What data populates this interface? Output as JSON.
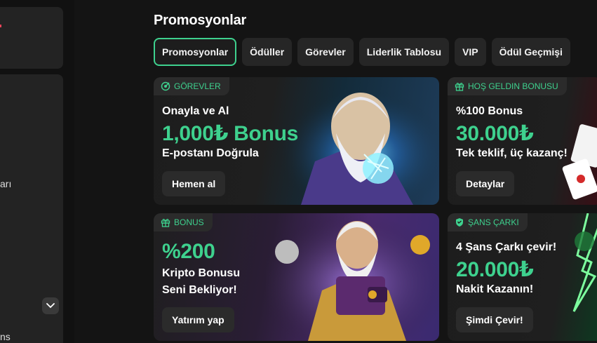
{
  "sidebar": {
    "partial_text_1": "arı",
    "partial_text_2": "ns"
  },
  "page": {
    "title": "Promosyonlar"
  },
  "tabs": [
    {
      "label": "Promosyonlar"
    },
    {
      "label": "Ödüller"
    },
    {
      "label": "Görevler"
    },
    {
      "label": "Liderlik Tablosu"
    },
    {
      "label": "VIP"
    },
    {
      "label": "Ödül Geçmişi"
    }
  ],
  "promos": {
    "a": {
      "badge": "GÖREVLER",
      "line1": "Onayla ve Al",
      "big": "1,000₺ Bonus",
      "line2": "E-postanı Doğrula",
      "button": "Hemen al",
      "icon": "target-icon"
    },
    "b": {
      "badge": "HOŞ GELDIN BONUSU",
      "line1": "%100 Bonus",
      "big": "30.000₺",
      "line2": "Tek teklif, üç kazanç!",
      "button": "Detaylar",
      "icon": "gift-icon"
    },
    "c": {
      "badge": "BONUS",
      "big": "%200",
      "line1": "Kripto Bonusu",
      "line2": "Seni Bekliyor!",
      "button": "Yatırım yap",
      "icon": "gift-icon"
    },
    "d": {
      "badge": "ŞANS ÇARKI",
      "line1": "4 Şans Çarkı çevir!",
      "big": "20.000₺",
      "line2": "Nakit Kazanın!",
      "button": "Şimdi Çevir!",
      "icon": "shield-icon"
    }
  },
  "colors": {
    "accent": "#3ed18e",
    "background": "#141414",
    "card": "#1f1f1f",
    "button": "#2b2b2b"
  }
}
